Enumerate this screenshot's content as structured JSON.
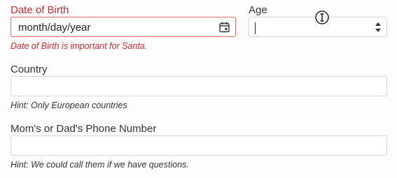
{
  "dob": {
    "label": "Date of Birth",
    "placeholder": "month/day/year",
    "error": "Date of Birth is important for Santa."
  },
  "age": {
    "label": "Age",
    "value": ""
  },
  "country": {
    "label": "Country",
    "value": "",
    "hint": "Hint: Only European countries"
  },
  "phone": {
    "label": "Mom's or Dad's Phone Number",
    "value": "",
    "hint": "Hint: We could call them if we have questions."
  },
  "colors": {
    "error": "#d9282d",
    "error_border": "#e06a6d",
    "border": "#d6d6d6",
    "text": "#333333"
  },
  "icons": {
    "dob_picker": "calendar-icon",
    "age_spinner": "spinner-arrows-icon",
    "pointer": "text-cursor-icon"
  }
}
